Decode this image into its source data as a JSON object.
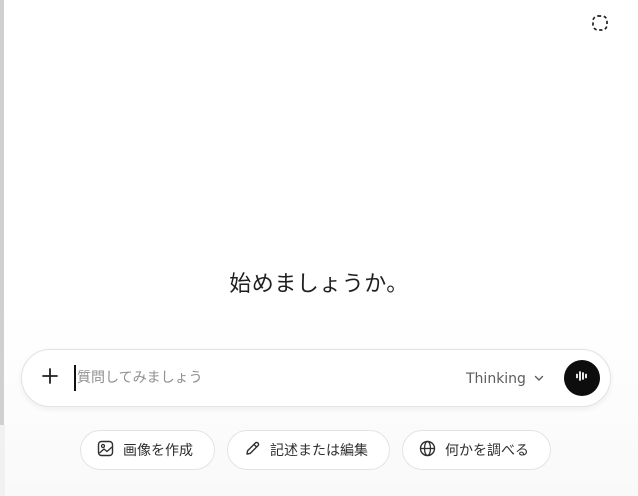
{
  "header": {
    "temp_chat_icon": "dashed-circle-icon"
  },
  "main": {
    "headline": "始めましょうか。"
  },
  "composer": {
    "attach_icon": "plus-icon",
    "placeholder": "質問してみましょう",
    "value": "",
    "model_label": "Thinking",
    "model_icon": "chevron-down-icon",
    "voice_icon": "voice-waveform-icon"
  },
  "chips": [
    {
      "label": "画像を作成",
      "icon": "image-icon"
    },
    {
      "label": "記述または編集",
      "icon": "pencil-icon"
    },
    {
      "label": "何かを調べる",
      "icon": "globe-icon"
    }
  ],
  "colors": {
    "voice_button": "#0d0d0d",
    "border": "#e3e3e3",
    "placeholder": "#8f8f8f"
  }
}
